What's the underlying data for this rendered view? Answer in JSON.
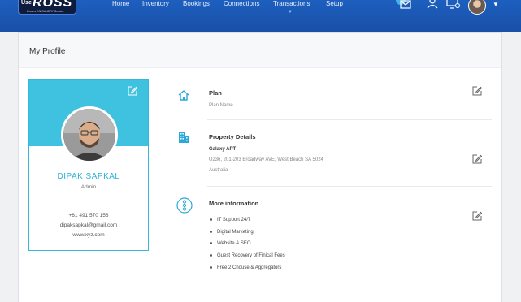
{
  "brand": {
    "use": "Use",
    "name": "ROSS",
    "tagline": "Rooms ON SUNDRY Service"
  },
  "nav": {
    "items": [
      {
        "label": "Home"
      },
      {
        "label": "Inventory"
      },
      {
        "label": "Bookings"
      },
      {
        "label": "Connections"
      },
      {
        "label": "Transactions"
      },
      {
        "label": "Setup"
      }
    ],
    "active": "Transactions"
  },
  "header_icons": [
    "mail-icon",
    "user-switch-icon",
    "monitor-user-icon",
    "avatar",
    "caret-down-icon"
  ],
  "page": {
    "title": "My Profile"
  },
  "profile": {
    "name": "DIPAK SAPKAL",
    "role": "Admin",
    "phone": "+61 491 570 156",
    "email": "dipaksapkal@gmail.com",
    "website": "www.xyz.com"
  },
  "sections": {
    "plan": {
      "title": "Plan",
      "value": "Plan Name"
    },
    "property": {
      "title": "Property Details",
      "name": "Galaxy APT",
      "address1": "U236, 201-203 Broadway AVE, West Beach SA 5024",
      "address2": "Australia"
    },
    "more": {
      "title": "More information",
      "items": [
        "IT Support 24/7",
        "Digital Marketing",
        "Website & SEO",
        "Guest Recovery of Finical Fees",
        "Free 2 Chouse & Aggregators"
      ]
    }
  },
  "colors": {
    "nav": "#1d5fbf",
    "accent": "#3ec2e0",
    "accent_text": "#2ab0d6"
  }
}
